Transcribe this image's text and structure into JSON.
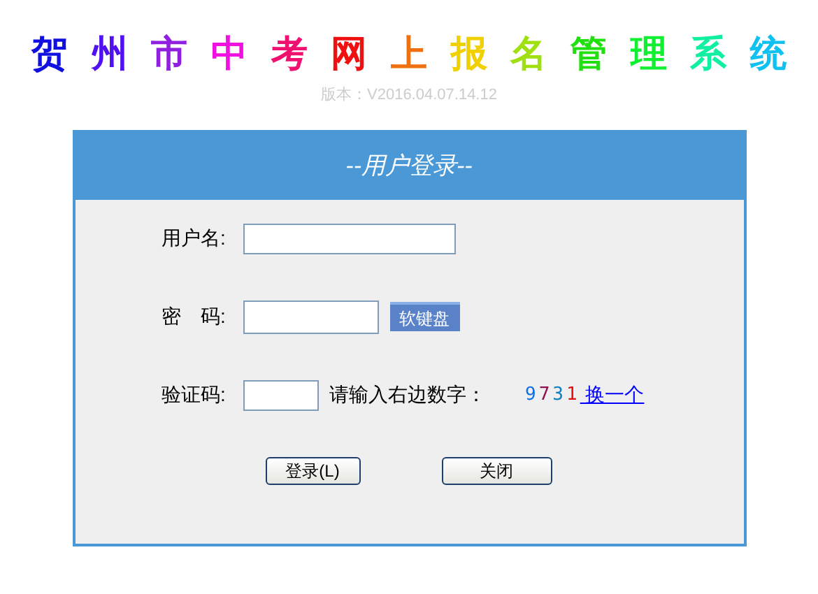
{
  "title_chars": [
    {
      "text": "贺",
      "color": "#1010e0"
    },
    {
      "text": "州",
      "color": "#5010f0"
    },
    {
      "text": "市",
      "color": "#9020e0"
    },
    {
      "text": "中",
      "color": "#f010e0"
    },
    {
      "text": "考",
      "color": "#f01070"
    },
    {
      "text": "网",
      "color": "#f01010"
    },
    {
      "text": "上",
      "color": "#f07010"
    },
    {
      "text": "报",
      "color": "#f0d000"
    },
    {
      "text": "名",
      "color": "#a0e010"
    },
    {
      "text": "管",
      "color": "#20e010"
    },
    {
      "text": "理",
      "color": "#10f030"
    },
    {
      "text": "系",
      "color": "#10f0a0"
    },
    {
      "text": "统",
      "color": "#10c0f0"
    }
  ],
  "version": "版本：V2016.04.07.14.12",
  "panel": {
    "title": "--用户登录--",
    "username_label": "用户名:",
    "password_label": "密　码:",
    "soft_keyboard_button": "软键盘",
    "captcha_label": "验证码:",
    "captcha_hint": "请输入右边数字：",
    "captcha_digits": [
      {
        "text": "9",
        "color": "#1070e0"
      },
      {
        "text": "7",
        "color": "#901050"
      },
      {
        "text": "3",
        "color": "#1080c0"
      },
      {
        "text": "1",
        "color": "#e01010"
      }
    ],
    "refresh_link": " 换一个",
    "buttons": [
      "登录(L)",
      "关闭"
    ]
  }
}
